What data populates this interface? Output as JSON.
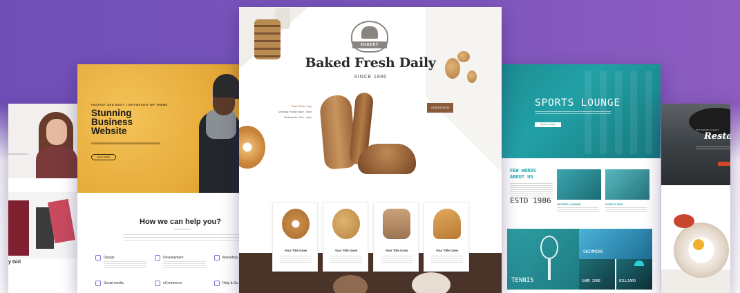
{
  "colors": {
    "background_gradient": [
      "#6f4fb7",
      "#8d5cc1"
    ],
    "business_accent": "#e7ac3b",
    "bakery_button": "#8a5a3a",
    "sports_accent": "#1aa3a9",
    "restaurant_button": "#d4462c",
    "service_icon": "#7b73d6"
  },
  "left_card": {
    "caption": "y Girl"
  },
  "business_card": {
    "tagline": "FASTEST AND MOST LIGHTWEIGHT WP THEME",
    "title": "Stunning Business Website",
    "button": "READ MORE",
    "help_heading": "How we can help you?",
    "services": [
      {
        "label": "Design",
        "icon": "pen-icon"
      },
      {
        "label": "Development",
        "icon": "monitor-icon"
      },
      {
        "label": "Marketing",
        "icon": "megaphone-icon"
      },
      {
        "label": "Social media",
        "icon": "share-icon"
      },
      {
        "label": "eCommerce",
        "icon": "cart-icon"
      },
      {
        "label": "Help & Su",
        "icon": "support-icon"
      }
    ]
  },
  "bakery_card": {
    "logo_text": "BAKERY",
    "title": "Baked Fresh Daily",
    "since": "SINCE 1986",
    "hours_heading": "Open Every Day",
    "hours_line1": "Monday-Friday: 6am - 5pm",
    "hours_line2": "Weekends: 7am - 4pm",
    "guides_button": "GUIDES NOW",
    "products": [
      {
        "title": "Your Title Goes"
      },
      {
        "title": "Your Title Goes"
      },
      {
        "title": "Your Title Goes"
      },
      {
        "title": "Your Title Goes"
      }
    ]
  },
  "sports_card": {
    "title": "SPORTS LOUNGE",
    "button": "BOOK A TABLE",
    "few_words": "FEW WORDS ABOUT US",
    "established": "ESTD 1986",
    "caption1": "SPORTS LOUNGE",
    "caption2": "FOOD & BAR",
    "tiles": {
      "tennis": "TENNIS",
      "swimming": "SWIMMING",
      "game_zone": "GAME ZONE",
      "billiard": "BILLIARD"
    }
  },
  "restaurant_card": {
    "small_text": "IT'S QUICK & EASY",
    "title": "Restau"
  }
}
